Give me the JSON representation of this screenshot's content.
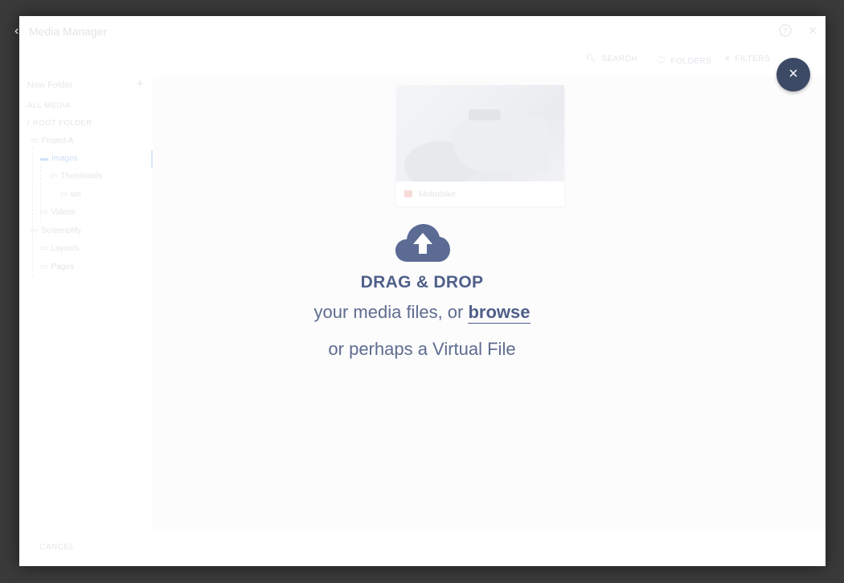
{
  "modal": {
    "title": "Media Manager",
    "help_icon": "question-circle-icon",
    "close_icon": "close-icon"
  },
  "toolbar": {
    "search_label": "SEARCH",
    "folders_label": "FOLDERS",
    "filters_label": "FILTERS"
  },
  "sidebar": {
    "new_folder": "New Folder",
    "all_media": "ALL MEDIA",
    "root_folder": "ROOT FOLDER",
    "tree": {
      "project_a": "Project A",
      "images": "Images",
      "thumbnails": "Thumbnails",
      "sm": "sm",
      "videos": "Videos",
      "screenplify": "Screenplify",
      "layouts": "Layouts",
      "pages": "Pages"
    }
  },
  "card": {
    "name": "Motorbike",
    "icon": "image-file-icon"
  },
  "dropzone": {
    "icon": "cloud-upload-icon",
    "headline": "DRAG & DROP",
    "line1_prefix": "your media files, or ",
    "browse": "browse",
    "line2": "or perhaps a Virtual File"
  },
  "footer": {
    "cancel": "CANCEL"
  },
  "overlay": {
    "close_icon": "close-icon",
    "close_symbol": "×"
  },
  "colors": {
    "accent": "#4f5f88",
    "fab": "#3d4a66",
    "backdrop": "#3a3a3a"
  }
}
